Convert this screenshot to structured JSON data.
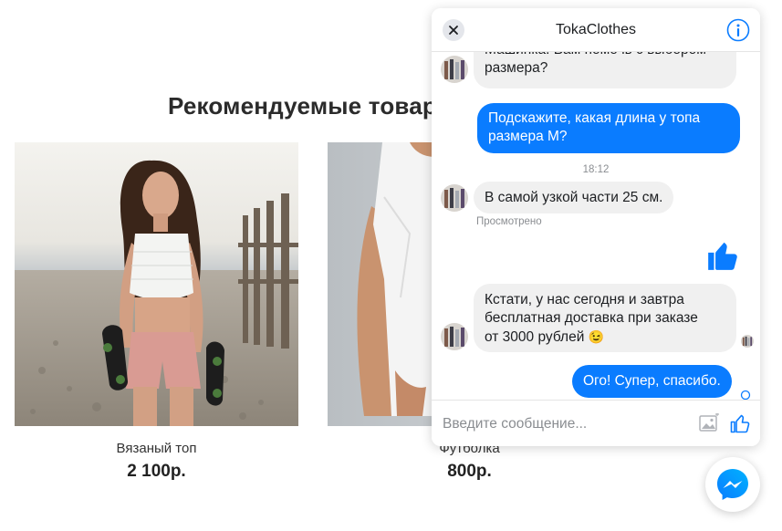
{
  "page": {
    "section_title": "Рекомендуемые товар",
    "products": [
      {
        "name": "Вязаный топ",
        "price": "2 100р."
      },
      {
        "name": "Футболка",
        "price": "800р."
      }
    ]
  },
  "chat": {
    "title": "TokaClothes",
    "messages": {
      "m1_line1": "Машинка. Вам помочь с выбором",
      "m1_line2": "размера?",
      "m2_line1": "Подскажите, какая длина у топа",
      "m2_line2": "размера M?",
      "timestamp": "18:12",
      "m3": "В самой узкой части 25 см.",
      "seen": "Просмотрено",
      "m5_line1": "Кстати, у нас сегодня и завтра",
      "m5_line2": "бесплатная доставка при заказе",
      "m5_line3": "от 3000 рублей",
      "m5_emoji": "😉",
      "m6": "Ого! Супер, спасибо."
    },
    "input_placeholder": "Введите сообщение..."
  },
  "colors": {
    "accent": "#0a7cff",
    "incoming_bubble": "#f0f0f0",
    "header_text": "#1c1e21"
  },
  "icons": {
    "close": "close-icon",
    "info": "info-icon",
    "like": "thumbs-up-icon",
    "photo": "photo-icon",
    "messenger": "messenger-icon"
  }
}
